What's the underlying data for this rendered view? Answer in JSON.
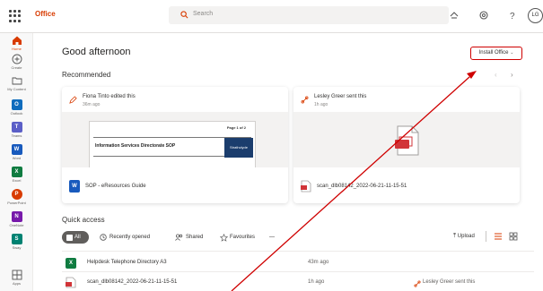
{
  "app": {
    "name": "Office"
  },
  "search": {
    "placeholder": "Search"
  },
  "header": {
    "avatar_initials": "LG"
  },
  "colors": {
    "accent": "#d83b01",
    "annotation": "#cf0000",
    "word": "#185abd",
    "excel": "#107c41",
    "outlook": "#0f6cbd",
    "onenote": "#7719aa",
    "teams": "#5b5fc7",
    "sway": "#008272"
  },
  "rail": {
    "items": [
      {
        "label": "Home",
        "icon": "home-icon"
      },
      {
        "label": "Create",
        "icon": "create-icon"
      },
      {
        "label": "My Content",
        "icon": "folder-icon"
      },
      {
        "label": "Outlook",
        "icon": "outlook-icon",
        "tile": "O"
      },
      {
        "label": "Teams",
        "icon": "teams-icon",
        "tile": "T"
      },
      {
        "label": "Word",
        "icon": "word-icon",
        "tile": "W"
      },
      {
        "label": "Excel",
        "icon": "excel-icon",
        "tile": "X"
      },
      {
        "label": "PowerPoint",
        "icon": "powerpoint-icon",
        "tile": "P"
      },
      {
        "label": "OneNote",
        "icon": "onenote-icon",
        "tile": "N"
      },
      {
        "label": "Sway",
        "icon": "sway-icon",
        "tile": "S"
      },
      {
        "label": "Apps",
        "icon": "apps-icon"
      }
    ]
  },
  "main": {
    "greeting": "Good afternoon",
    "install_button": "Install Office",
    "recommended_title": "Recommended",
    "carousel_prev": "‹",
    "carousel_next": "›",
    "cards": [
      {
        "actor": "Fiona Tinto edited this",
        "time": "36m ago",
        "file_name": "SOP - eResources Guide",
        "thumb_page": "Page 1 of 2",
        "thumb_title": "Information Services Directorate SOP",
        "thumb_logo": "Strathclyde"
      },
      {
        "actor": "Lesley Greer sent this",
        "time": "1h ago",
        "file_name": "scan_dlb08142_2022-06-21-11-15-51"
      }
    ],
    "quick_access_title": "Quick access",
    "filters": [
      "All",
      "Recently opened",
      "Shared",
      "Favourites"
    ],
    "filter_more": "—",
    "upload_label": "Upload",
    "files": [
      {
        "name": "Helpdesk Telephone Directory A3",
        "date": "43m ago",
        "activity": "",
        "icon": "excel-file-icon"
      },
      {
        "name": "scan_dlb08142_2022-06-21-11-15-51",
        "date": "1h ago",
        "activity": "Lesley Greer sent this",
        "icon": "pdf-file-icon"
      }
    ]
  }
}
